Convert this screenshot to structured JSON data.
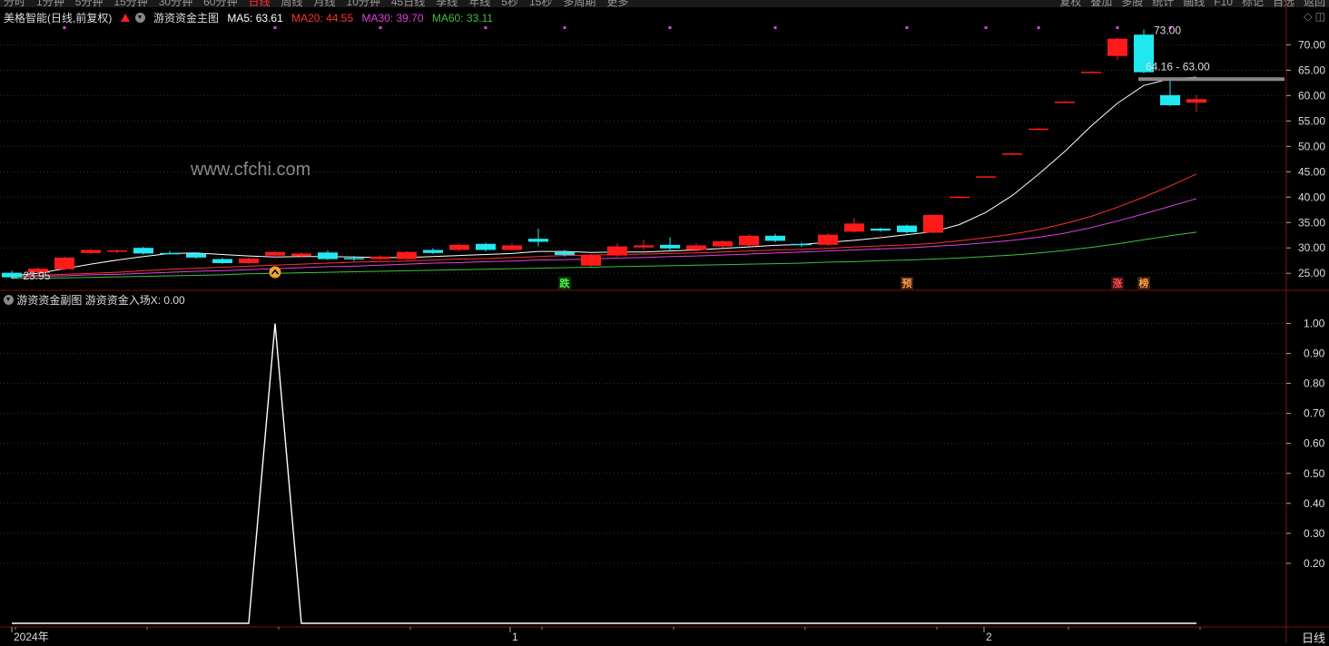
{
  "top_menu": {
    "periods": [
      "分时",
      "1分钟",
      "5分钟",
      "15分钟",
      "30分钟",
      "60分钟",
      "日线",
      "周线",
      "月线",
      "10分钟",
      "45日线",
      "季线",
      "年线",
      "5秒",
      "15秒",
      "多周期",
      "更多"
    ],
    "active_period": "日线",
    "right_items": [
      "复权",
      "叠加",
      "多股",
      "统计",
      "画线",
      "F10",
      "标记",
      "自选",
      "返回"
    ]
  },
  "main_panel": {
    "stock": "美格智能(日线,前复权)",
    "indicator": "游资资金主图",
    "ma": [
      {
        "label": "MA5: 63.61",
        "color": "#ffffff"
      },
      {
        "label": "MA20: 44.55",
        "color": "#ff3030"
      },
      {
        "label": "MA30: 39.70",
        "color": "#e040e0"
      },
      {
        "label": "MA60: 33.11",
        "color": "#40c040"
      }
    ]
  },
  "sub_panel": {
    "indicator": "游资资金副图",
    "line_label": "游资资金入场X: 0.00"
  },
  "watermark": "www.cfchi.com",
  "annotations": {
    "high": "73.00",
    "range": "64.16 - 63.00",
    "low": "← 23.95"
  },
  "markers": [
    {
      "text": "跌",
      "color": "#40ff40",
      "bg": "#103010",
      "index": 21
    },
    {
      "text": "预",
      "color": "#ffa040",
      "bg": "#3a2010",
      "index": 34
    },
    {
      "text": "涨",
      "color": "#ff5050",
      "bg": "#3a1010",
      "index": 42
    },
    {
      "text": "榜",
      "color": "#ffa040",
      "bg": "#3a2010",
      "index": 43
    }
  ],
  "x_axis": {
    "labels": [
      {
        "text": "2024年",
        "index": 0
      },
      {
        "text": "1",
        "index": 19
      },
      {
        "text": "2",
        "index": 37
      }
    ]
  },
  "period_label": "日线",
  "chart_data": [
    {
      "type": "candlestick",
      "ylim": [
        22,
        74
      ],
      "yticks": [
        25,
        30,
        35,
        40,
        45,
        50,
        55,
        60,
        65,
        70
      ],
      "candles": [
        {
          "o": 25.1,
          "h": 25.5,
          "l": 23.95,
          "c": 24.2
        },
        {
          "o": 25.2,
          "h": 26.2,
          "l": 24.9,
          "c": 25.9
        },
        {
          "o": 25.8,
          "h": 28.3,
          "l": 25.6,
          "c": 28.1
        },
        {
          "o": 29.0,
          "h": 29.8,
          "l": 28.8,
          "c": 29.6
        },
        {
          "o": 29.3,
          "h": 29.7,
          "l": 29.0,
          "c": 29.5
        },
        {
          "o": 30.0,
          "h": 30.2,
          "l": 28.7,
          "c": 28.9
        },
        {
          "o": 29.0,
          "h": 29.4,
          "l": 28.7,
          "c": 28.9
        },
        {
          "o": 28.9,
          "h": 29.1,
          "l": 27.9,
          "c": 28.1
        },
        {
          "o": 27.8,
          "h": 28.0,
          "l": 26.9,
          "c": 27.0
        },
        {
          "o": 27.0,
          "h": 28.1,
          "l": 26.9,
          "c": 27.9
        },
        {
          "o": 28.5,
          "h": 29.4,
          "l": 27.9,
          "c": 29.2
        },
        {
          "o": 28.4,
          "h": 29.1,
          "l": 28.0,
          "c": 28.9
        },
        {
          "o": 29.1,
          "h": 29.5,
          "l": 27.6,
          "c": 27.8
        },
        {
          "o": 28.0,
          "h": 28.4,
          "l": 27.4,
          "c": 27.8
        },
        {
          "o": 27.8,
          "h": 28.5,
          "l": 27.5,
          "c": 28.3
        },
        {
          "o": 27.8,
          "h": 29.4,
          "l": 27.6,
          "c": 29.2
        },
        {
          "o": 29.6,
          "h": 29.9,
          "l": 28.8,
          "c": 29.0
        },
        {
          "o": 29.6,
          "h": 30.9,
          "l": 29.3,
          "c": 30.6
        },
        {
          "o": 30.8,
          "h": 31.0,
          "l": 29.3,
          "c": 29.6
        },
        {
          "o": 29.6,
          "h": 30.9,
          "l": 29.4,
          "c": 30.5
        },
        {
          "o": 31.8,
          "h": 33.8,
          "l": 30.3,
          "c": 31.2
        },
        {
          "o": 29.2,
          "h": 29.6,
          "l": 28.3,
          "c": 28.6
        },
        {
          "o": 26.5,
          "h": 28.8,
          "l": 26.3,
          "c": 28.5
        },
        {
          "o": 28.5,
          "h": 30.9,
          "l": 28.2,
          "c": 30.3
        },
        {
          "o": 30.1,
          "h": 31.6,
          "l": 29.6,
          "c": 30.5
        },
        {
          "o": 30.6,
          "h": 32.1,
          "l": 29.3,
          "c": 29.9
        },
        {
          "o": 29.6,
          "h": 30.9,
          "l": 29.2,
          "c": 30.5
        },
        {
          "o": 30.3,
          "h": 31.5,
          "l": 30.0,
          "c": 31.3
        },
        {
          "o": 30.5,
          "h": 32.7,
          "l": 30.3,
          "c": 32.4
        },
        {
          "o": 32.4,
          "h": 32.8,
          "l": 31.1,
          "c": 31.4
        },
        {
          "o": 30.8,
          "h": 31.1,
          "l": 30.2,
          "c": 30.7
        },
        {
          "o": 30.6,
          "h": 32.9,
          "l": 30.4,
          "c": 32.6
        },
        {
          "o": 33.2,
          "h": 35.9,
          "l": 33.0,
          "c": 34.8
        },
        {
          "o": 33.8,
          "h": 34.0,
          "l": 33.2,
          "c": 33.4
        },
        {
          "o": 34.4,
          "h": 34.6,
          "l": 32.8,
          "c": 33.1
        },
        {
          "o": 33.0,
          "h": 36.6,
          "l": 32.9,
          "c": 36.5
        },
        {
          "o": 40.1,
          "h": 40.2,
          "l": 40.0,
          "c": 40.1
        },
        {
          "o": 44.1,
          "h": 44.2,
          "l": 44.0,
          "c": 44.1
        },
        {
          "o": 48.6,
          "h": 48.7,
          "l": 48.5,
          "c": 48.6
        },
        {
          "o": 53.5,
          "h": 53.6,
          "l": 53.4,
          "c": 53.5
        },
        {
          "o": 58.8,
          "h": 58.9,
          "l": 58.7,
          "c": 58.8
        },
        {
          "o": 64.7,
          "h": 64.8,
          "l": 64.6,
          "c": 64.7
        },
        {
          "o": 67.8,
          "h": 71.4,
          "l": 67.0,
          "c": 71.2
        },
        {
          "o": 72.0,
          "h": 73.0,
          "l": 64.4,
          "c": 64.6
        },
        {
          "o": 60.1,
          "h": 63.6,
          "l": 57.9,
          "c": 58.1
        },
        {
          "o": 58.6,
          "h": 60.1,
          "l": 56.8,
          "c": 59.3
        }
      ],
      "ma5": [
        24.5,
        25.0,
        25.9,
        26.8,
        27.6,
        28.3,
        28.9,
        29.0,
        28.7,
        28.4,
        28.2,
        28.3,
        28.3,
        28.2,
        28.1,
        28.1,
        28.3,
        28.5,
        28.7,
        28.9,
        29.3,
        29.3,
        29.1,
        29.2,
        29.2,
        29.4,
        29.6,
        29.9,
        30.2,
        30.5,
        30.7,
        31.1,
        31.5,
        32.0,
        32.6,
        33.2,
        34.6,
        37.0,
        40.3,
        44.5,
        49.0,
        54.0,
        58.5,
        62.0,
        63.3,
        63.61
      ],
      "ma20": [
        24.4,
        24.6,
        24.8,
        25.0,
        25.2,
        25.5,
        25.8,
        26.0,
        26.2,
        26.4,
        26.6,
        26.8,
        27.0,
        27.2,
        27.3,
        27.4,
        27.6,
        27.8,
        27.9,
        28.1,
        28.3,
        28.5,
        28.6,
        28.7,
        28.8,
        28.9,
        29.0,
        29.2,
        29.4,
        29.6,
        29.7,
        29.9,
        30.2,
        30.4,
        30.6,
        30.9,
        31.4,
        32.0,
        32.7,
        33.6,
        34.8,
        36.2,
        38.0,
        40.0,
        42.2,
        44.55
      ],
      "ma30": [
        24.3,
        24.4,
        24.5,
        24.7,
        24.8,
        25.0,
        25.2,
        25.4,
        25.5,
        25.7,
        25.9,
        26.1,
        26.3,
        26.4,
        26.6,
        26.8,
        27.0,
        27.1,
        27.3,
        27.4,
        27.6,
        27.7,
        27.8,
        28.0,
        28.1,
        28.3,
        28.4,
        28.6,
        28.8,
        29.0,
        29.2,
        29.4,
        29.6,
        29.8,
        30.0,
        30.3,
        30.6,
        31.0,
        31.5,
        32.1,
        32.9,
        34.0,
        35.3,
        36.7,
        38.2,
        39.7
      ],
      "ma60": [
        24.0,
        24.0,
        24.1,
        24.2,
        24.3,
        24.4,
        24.5,
        24.6,
        24.7,
        24.9,
        25.0,
        25.1,
        25.2,
        25.3,
        25.4,
        25.5,
        25.6,
        25.7,
        25.8,
        25.9,
        26.0,
        26.1,
        26.2,
        26.3,
        26.4,
        26.5,
        26.6,
        26.7,
        26.8,
        26.9,
        27.0,
        27.2,
        27.3,
        27.5,
        27.6,
        27.8,
        28.0,
        28.3,
        28.6,
        29.0,
        29.5,
        30.1,
        30.8,
        31.6,
        32.4,
        33.11
      ],
      "dots_index": [
        2,
        10,
        14,
        18,
        21,
        25,
        29,
        34,
        37,
        39,
        42,
        44
      ]
    },
    {
      "type": "line",
      "ylim": [
        0,
        1.05
      ],
      "yticks": [
        0.2,
        0.3,
        0.4,
        0.5,
        0.6,
        0.7,
        0.8,
        0.9,
        1.0
      ],
      "series": [
        {
          "values": [
            0,
            0,
            0,
            0,
            0,
            0,
            0,
            0,
            0,
            0,
            1,
            0,
            0,
            0,
            0,
            0,
            0,
            0,
            0,
            0,
            0,
            0,
            0,
            0,
            0,
            0,
            0,
            0,
            0,
            0,
            0,
            0,
            0,
            0,
            0,
            0,
            0,
            0,
            0,
            0,
            0,
            0,
            0,
            0,
            0,
            0
          ]
        }
      ]
    }
  ]
}
